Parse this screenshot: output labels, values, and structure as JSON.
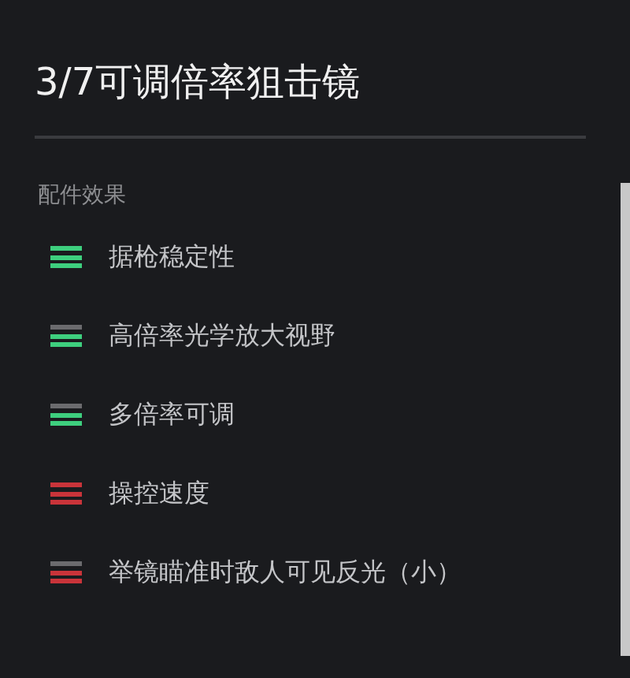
{
  "title": "3/7可调倍率狙击镜",
  "section": {
    "heading": "配件效果"
  },
  "effects": [
    {
      "label": "据枪稳定性",
      "kind": "positive",
      "bars": [
        {
          "filled": true
        },
        {
          "filled": true
        },
        {
          "filled": true
        }
      ]
    },
    {
      "label": "高倍率光学放大视野",
      "kind": "positive",
      "bars": [
        {
          "filled": false
        },
        {
          "filled": true
        },
        {
          "filled": true
        }
      ]
    },
    {
      "label": "多倍率可调",
      "kind": "positive",
      "bars": [
        {
          "filled": false
        },
        {
          "filled": true
        },
        {
          "filled": true
        }
      ]
    },
    {
      "label": "操控速度",
      "kind": "negative",
      "bars": [
        {
          "filled": true
        },
        {
          "filled": true
        },
        {
          "filled": true
        }
      ]
    },
    {
      "label": "举镜瞄准时敌人可见反光（小）",
      "kind": "negative",
      "bars": [
        {
          "filled": false
        },
        {
          "filled": true
        },
        {
          "filled": true
        }
      ]
    }
  ]
}
